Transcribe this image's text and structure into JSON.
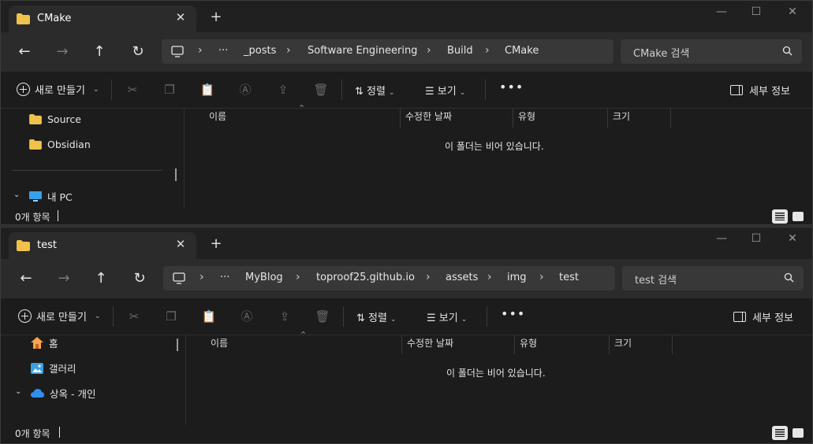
{
  "windows": [
    {
      "tab_title": "CMake",
      "breadcrumbs": [
        "_posts",
        "Software Engineering",
        "Build",
        "CMake"
      ],
      "search_placeholder": "CMake 검색",
      "toolbar": {
        "new_label": "새로 만들기",
        "sort_label": "정렬",
        "view_label": "보기",
        "details_label": "세부 정보"
      },
      "sidebar": [
        {
          "label": "Source",
          "icon": "folder-icon"
        },
        {
          "label": "Obsidian",
          "icon": "folder-icon"
        },
        {
          "label": "내 PC",
          "icon": "pc-icon"
        }
      ],
      "columns": [
        "이름",
        "수정한 날짜",
        "유형",
        "크기"
      ],
      "empty_message": "이 폴더는 비어 있습니다.",
      "status": "0개 항목"
    },
    {
      "tab_title": "test",
      "breadcrumbs": [
        "MyBlog",
        "toproof25.github.io",
        "assets",
        "img",
        "test"
      ],
      "search_placeholder": "test 검색",
      "toolbar": {
        "new_label": "새로 만들기",
        "sort_label": "정렬",
        "view_label": "보기",
        "details_label": "세부 정보"
      },
      "sidebar": [
        {
          "label": "홈",
          "icon": "home-icon"
        },
        {
          "label": "갤러리",
          "icon": "gallery-icon"
        },
        {
          "label": "상옥 - 개인",
          "icon": "cloud-icon"
        }
      ],
      "columns": [
        "이름",
        "수정한 날짜",
        "유형",
        "크기"
      ],
      "empty_message": "이 폴더는 비어 있습니다.",
      "status": "0개 항목"
    }
  ],
  "colors": {
    "window_bg": "#1c1c1c",
    "titlebar_bg": "#202020",
    "tab_bg": "#2b2b2b",
    "field_bg": "#383838",
    "folder": "#f0c24b",
    "onedrive": "#2f8ff0"
  }
}
